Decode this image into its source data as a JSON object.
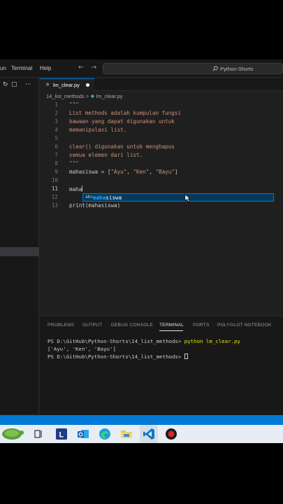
{
  "menu": {
    "partial_item": "un",
    "terminal": "Terminal",
    "help": "Help"
  },
  "search": {
    "text": "Python-Shorts"
  },
  "tab": {
    "filename": "lm_clear.py"
  },
  "breadcrumb": {
    "folder": "14_list_methods",
    "separator": ">",
    "file": "lm_clear.py"
  },
  "editor": {
    "line_numbers": [
      "1",
      "2",
      "3",
      "4",
      "5",
      "6",
      "7",
      "8",
      "9",
      "10",
      "11",
      "12",
      "13"
    ],
    "lines": [
      "\"\"\"",
      "List methods adalah kumpulan fungsi",
      "bawaan yang dapat digunakan untuk",
      "memanipulasi list.",
      "",
      "clear() digunakan untuk menghapus",
      "semua elemen dari list.",
      "\"\"\"",
      "",
      "",
      "maha",
      "",
      "print(mahasiswa)"
    ],
    "line9": {
      "lhs": "mahasiswa = [",
      "s1": "\"Ayu\"",
      "sep1": ", ",
      "s2": "\"Ken\"",
      "sep2": ", ",
      "s3": "\"Bayu\"",
      "rhs": "]"
    }
  },
  "suggestion": {
    "icon": "abc",
    "match": "maha",
    "rest": "siswa"
  },
  "panel": {
    "tabs": [
      "PROBLEMS",
      "OUTPUT",
      "DEBUG CONSOLE",
      "TERMINAL",
      "PORTS",
      "POLYGLOT NOTEBOOK"
    ],
    "terminal": {
      "prompt1": "PS D:\\GitHub\\Python-Shorts\\14_list_methods> ",
      "command": "python lm_clear.py",
      "output": "['Ayu', 'Ken', 'Bayu']",
      "prompt2": "PS D:\\GitHub\\Python-Shorts\\14_list_methods> "
    }
  },
  "colors": {
    "status_bar": "#0078d4",
    "string": "#ce9178",
    "terminal_command": "#e5e510"
  }
}
